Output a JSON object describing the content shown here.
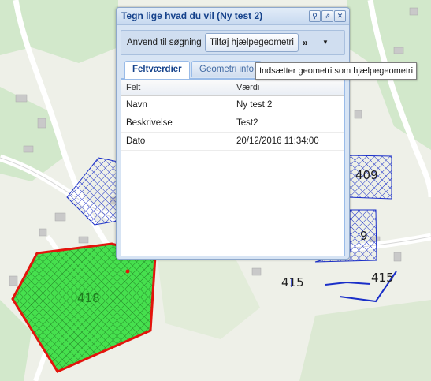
{
  "window": {
    "title": "Tegn lige hvad du vil (Ny test 2)",
    "search_btn_icon": "search-icon",
    "popout_btn_icon": "popout-icon",
    "close_btn_icon": "close-icon"
  },
  "toolbar": {
    "apply_label": "Anvend til søgning",
    "add_helper_label": "Tilføj hjælpegeometri",
    "more_label": "»",
    "more_arrow": "▼"
  },
  "tabs": [
    {
      "label": "Feltværdier",
      "active": true
    },
    {
      "label": "Geometri info",
      "active": false
    }
  ],
  "tooltip": "Indsætter geometri som hjælpegeometri",
  "grid": {
    "columns": [
      "Felt",
      "Værdi"
    ],
    "rows": [
      {
        "field": "Navn",
        "value": "Ny test 2"
      },
      {
        "field": "Beskrivelse",
        "value": "Test2"
      },
      {
        "field": "Dato",
        "value": "20/12/2016 11:34:00"
      }
    ]
  },
  "map": {
    "labels": [
      "409",
      "418",
      "415",
      "415",
      "9"
    ],
    "colors": {
      "polygon_fill": "#46e04e",
      "polygon_stroke": "#e3140c",
      "hatch_blue": "#1a2fc8",
      "road": "#ffffff",
      "land": "#eef0e8",
      "green_area": "#cfe6c6"
    }
  }
}
